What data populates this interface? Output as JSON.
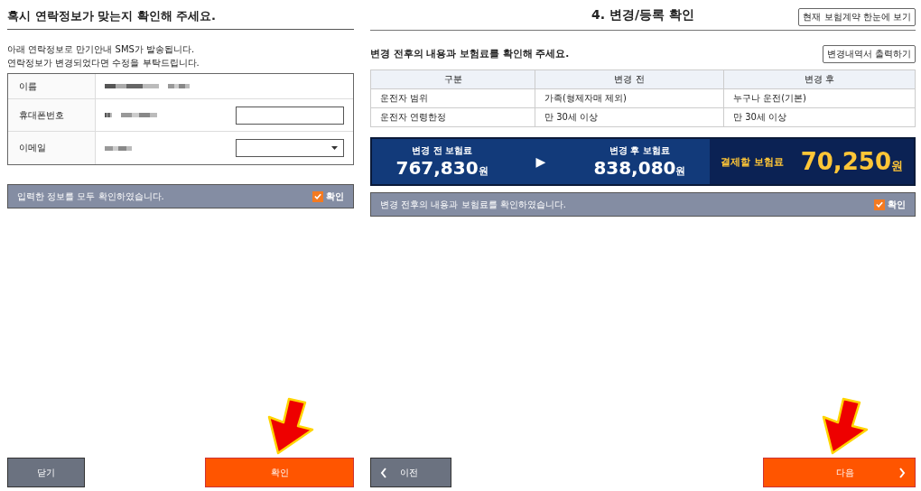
{
  "left_panel": {
    "title": "혹시 연락정보가 맞는지 확인해 주세요.",
    "notes": [
      "아래 연락정보로 만기안내 SMS가 발송됩니다.",
      "연락정보가 변경되었다면 수정을 부탁드립니다."
    ],
    "contact_rows": [
      {
        "label": "이름",
        "kind": "text"
      },
      {
        "label": "휴대폰번호",
        "kind": "input"
      },
      {
        "label": "이메일",
        "kind": "select"
      }
    ],
    "confirm": {
      "text": "입력한 정보를 모두 확인하였습니다.",
      "checkbox_label": "확인",
      "checked": true
    },
    "buttons": [
      {
        "label": "닫기",
        "kind": "secondary"
      },
      {
        "label": "확인",
        "kind": "primary"
      }
    ]
  },
  "right_panel": {
    "title": "4. 변경/등록 확인",
    "header_button": "현재 보험계약 한눈에 보기",
    "subtitle": "변경 전후의 내용과 보험료를 확인해 주세요.",
    "print_button": "변경내역서 출력하기",
    "table": {
      "columns": [
        "구분",
        "변경 전",
        "변경 후"
      ],
      "rows": [
        [
          "운전자 범위",
          "가족(형제자매 제외)",
          "누구나 운전(기본)"
        ],
        [
          "운전자 연령한정",
          "만 30세 이상",
          "만 30세 이상"
        ]
      ]
    },
    "premium": {
      "before_label": "변경 전 보험료",
      "before_amount": "767,830",
      "before_unit": "원",
      "arrow": "▶",
      "after_label": "변경 후 보험료",
      "after_amount": "838,080",
      "after_unit": "원",
      "pay_label": "결제할 보험료",
      "pay_amount": "70,250",
      "pay_unit": "원"
    },
    "confirm": {
      "text": "변경 전후의 내용과 보험료를 확인하였습니다.",
      "checkbox_label": "확인",
      "checked": true
    },
    "buttons": [
      {
        "label": "이전",
        "kind": "back"
      },
      {
        "label": "다음",
        "kind": "next"
      }
    ]
  }
}
